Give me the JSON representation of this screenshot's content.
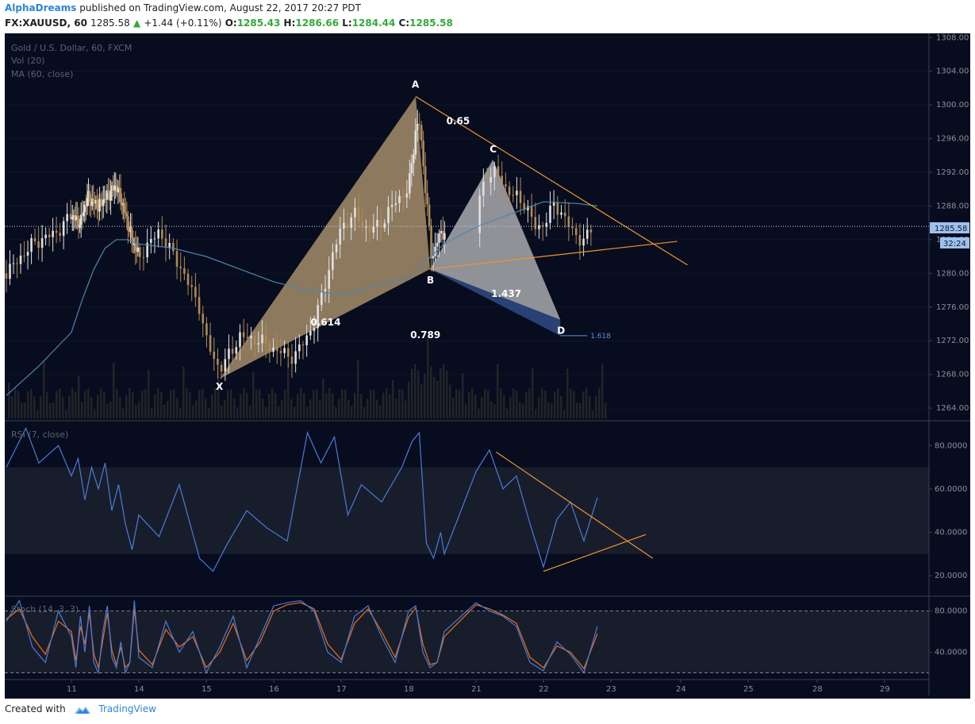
{
  "header": {
    "author": "AlphaDreams",
    "published": "published on TradingView.com, August 22, 2017 20:27 PDT",
    "symbol": "FX:XAUUSD, 60",
    "last": "1285.58",
    "change": "+1.44 (+0.11%)",
    "o_label": "O:",
    "o_value": "1285.43",
    "h_label": "H:",
    "h_value": "1286.66",
    "l_label": "L:",
    "l_value": "1284.44",
    "c_label": "C:",
    "c_value": "1285.58"
  },
  "legend": {
    "line1": "Gold / U.S. Dollar, 60, FXCM",
    "line2": "Vol (20)",
    "line3": "MA (60, close)",
    "rsi": "RSI (7, close)",
    "stoch": "Stoch (14, 3, 3)"
  },
  "price_badge": "1285.58",
  "countdown_badge": "32:24",
  "footer": {
    "created_with": "Created with",
    "brand": "TradingView"
  },
  "colors": {
    "background": "#070d1f",
    "pattern_fill": "#c2a477",
    "pattern_fill2": "#c7c5c7",
    "pattern_blue": "#2f4b85",
    "trendline": "#f1952e",
    "ma": "#4d86b0",
    "rsi": "#4b7bd6",
    "stoch_k": "#4b7bd6",
    "stoch_d": "#e86f1d"
  },
  "chart_data": [
    {
      "type": "candlestick",
      "title": "Gold / U.S. Dollar, 60, FXCM",
      "x_ticks": [
        "11",
        "14",
        "15",
        "16",
        "17",
        "18",
        "21",
        "22",
        "23",
        "24",
        "25",
        "28",
        "29"
      ],
      "y_ticks": [
        "1264.00",
        "1268.00",
        "1272.00",
        "1276.00",
        "1280.00",
        "1284.00",
        "1288.00",
        "1292.00",
        "1296.00",
        "1300.00",
        "1304.00",
        "1308.00"
      ],
      "ylim": [
        1262.5,
        1308.5
      ],
      "last_price": 1285.58,
      "harmonic_pattern": {
        "points": [
          {
            "label": "X",
            "x": 15.2,
            "price": 1267.5
          },
          {
            "label": "A",
            "x": 18.2,
            "price": 1301.0
          },
          {
            "label": "B",
            "x": 18.6,
            "price": 1280.5
          },
          {
            "label": "C",
            "x": 21.25,
            "price": 1293.5
          },
          {
            "label": "D",
            "x": 22.25,
            "price": 1274.5
          }
        ],
        "ratios": [
          "0.614",
          "0.789",
          "0.65",
          "1.437"
        ],
        "target_ratio": "1.618",
        "target_price": 1272.6
      },
      "series": [
        {
          "name": "price",
          "x": [
            10.0,
            10.4,
            10.8,
            11.0,
            11.4,
            11.7,
            12.2,
            13.0,
            13.3,
            13.7,
            14.0,
            14.3,
            14.6,
            14.9,
            15.0,
            15.2,
            15.5,
            15.8,
            16.0,
            16.3,
            16.6,
            16.8,
            17.0,
            17.2,
            17.4,
            17.6,
            17.8,
            18.0,
            18.2,
            18.3,
            18.5,
            18.65,
            18.8,
            19.0,
            21.0,
            21.15,
            21.3,
            21.45,
            21.6,
            21.75,
            21.9,
            22.0,
            22.15,
            22.3,
            22.45,
            22.6,
            22.75
          ],
          "values": [
            1280.0,
            1283.5,
            1285.0,
            1287.0,
            1286.0,
            1289.0,
            1288.0,
            1290.5,
            1288.0,
            1284.0,
            1282.0,
            1285.0,
            1281.0,
            1276.0,
            1272.0,
            1268.5,
            1272.5,
            1272.0,
            1271.0,
            1270.0,
            1274.0,
            1280.0,
            1285.5,
            1287.0,
            1285.0,
            1286.0,
            1288.5,
            1290.0,
            1297.0,
            1298.0,
            1289.0,
            1281.5,
            1284.0,
            1285.0,
            1287.5,
            1291.5,
            1292.0,
            1290.0,
            1289.0,
            1288.0,
            1285.0,
            1286.0,
            1288.0,
            1287.0,
            1284.5,
            1284.0,
            1285.58
          ]
        },
        {
          "name": "MA (60, close)",
          "x": [
            10.0,
            10.5,
            11.0,
            11.5,
            12.0,
            12.5,
            13.0,
            13.5,
            14.0,
            14.5,
            15.0,
            15.5,
            16.0,
            16.5,
            17.0,
            17.5,
            18.0,
            18.5,
            19.0,
            21.0,
            21.5,
            22.0,
            22.5,
            22.8
          ],
          "values": [
            1265.5,
            1269.0,
            1273.0,
            1277.0,
            1280.5,
            1283.0,
            1284.0,
            1284.0,
            1283.5,
            1283.0,
            1282.0,
            1280.5,
            1279.0,
            1278.0,
            1277.5,
            1278.5,
            1279.5,
            1281.5,
            1283.5,
            1285.5,
            1287.0,
            1288.5,
            1288.3,
            1288.0
          ]
        }
      ]
    },
    {
      "type": "line",
      "title": "RSI (7, close)",
      "y_ticks": [
        "20.0000",
        "40.0000",
        "60.0000",
        "80.0000"
      ],
      "ylim": [
        12,
        90
      ],
      "bands": [
        30,
        70
      ],
      "x": [
        10.0,
        10.3,
        10.5,
        10.8,
        11.0,
        11.3,
        11.6,
        11.9,
        12.2,
        12.5,
        12.8,
        13.1,
        13.4,
        13.7,
        14.0,
        14.3,
        14.6,
        14.9,
        15.1,
        15.3,
        15.6,
        15.9,
        16.2,
        16.5,
        16.7,
        16.9,
        17.1,
        17.3,
        17.6,
        17.9,
        18.1,
        18.3,
        18.5,
        18.7,
        18.9,
        19.0,
        21.0,
        21.2,
        21.4,
        21.6,
        21.8,
        22.0,
        22.2,
        22.4,
        22.6,
        22.8
      ],
      "values": [
        70,
        88,
        72,
        80,
        66,
        74,
        55,
        70,
        60,
        72,
        50,
        62,
        44,
        32,
        48,
        38,
        62,
        28,
        22,
        34,
        50,
        42,
        36,
        86,
        72,
        84,
        48,
        62,
        54,
        70,
        82,
        86,
        35,
        28,
        40,
        30,
        68,
        78,
        60,
        66,
        44,
        24,
        46,
        54,
        36,
        56
      ],
      "trendlines": [
        {
          "from": [
            21.3,
            77
          ],
          "to": [
            23.6,
            28
          ]
        },
        {
          "from": [
            22.0,
            22
          ],
          "to": [
            23.5,
            39
          ]
        }
      ]
    },
    {
      "type": "line",
      "title": "Stoch (14, 3, 3)",
      "y_ticks": [
        "40.0000",
        "80.0000"
      ],
      "ylim": [
        15,
        92
      ],
      "bands": [
        20,
        80
      ],
      "series": [
        {
          "name": "%K",
          "x": [
            10.0,
            10.2,
            10.4,
            10.6,
            10.8,
            11.0,
            11.2,
            11.4,
            11.6,
            11.8,
            12.0,
            12.2,
            12.4,
            12.6,
            12.8,
            13.0,
            13.2,
            13.4,
            13.6,
            13.8,
            14.0,
            14.2,
            14.4,
            14.6,
            14.8,
            15.0,
            15.2,
            15.4,
            15.6,
            15.8,
            16.0,
            16.2,
            16.4,
            16.6,
            16.8,
            17.0,
            17.2,
            17.4,
            17.6,
            17.8,
            18.0,
            18.2,
            18.4,
            18.6,
            18.8,
            19.0,
            21.0,
            21.2,
            21.4,
            21.6,
            21.8,
            22.0,
            22.2,
            22.4,
            22.6,
            22.8
          ],
          "values": [
            70,
            90,
            45,
            30,
            80,
            55,
            25,
            75,
            40,
            85,
            30,
            20,
            60,
            85,
            35,
            25,
            50,
            20,
            30,
            90,
            35,
            25,
            70,
            40,
            60,
            20,
            45,
            75,
            25,
            55,
            85,
            88,
            90,
            80,
            40,
            30,
            75,
            85,
            55,
            30,
            80,
            85,
            40,
            25,
            30,
            60,
            88,
            80,
            75,
            65,
            30,
            22,
            50,
            38,
            20,
            65
          ]
        },
        {
          "name": "%D",
          "x": [
            10.0,
            10.2,
            10.4,
            10.6,
            10.8,
            11.0,
            11.2,
            11.4,
            11.6,
            11.8,
            12.0,
            12.2,
            12.4,
            12.6,
            12.8,
            13.0,
            13.2,
            13.4,
            13.6,
            13.8,
            14.0,
            14.2,
            14.4,
            14.6,
            14.8,
            15.0,
            15.2,
            15.4,
            15.6,
            15.8,
            16.0,
            16.2,
            16.4,
            16.6,
            16.8,
            17.0,
            17.2,
            17.4,
            17.6,
            17.8,
            18.0,
            18.2,
            18.4,
            18.6,
            18.8,
            19.0,
            21.0,
            21.2,
            21.4,
            21.6,
            21.8,
            22.0,
            22.2,
            22.4,
            22.6,
            22.8
          ],
          "values": [
            72,
            82,
            55,
            38,
            70,
            60,
            32,
            65,
            48,
            78,
            38,
            25,
            52,
            78,
            42,
            28,
            45,
            25,
            30,
            82,
            42,
            28,
            62,
            45,
            55,
            25,
            40,
            68,
            32,
            50,
            80,
            86,
            88,
            82,
            48,
            33,
            68,
            82,
            60,
            35,
            74,
            83,
            48,
            28,
            30,
            55,
            86,
            82,
            76,
            68,
            35,
            25,
            46,
            40,
            24,
            58
          ]
        }
      ]
    }
  ]
}
